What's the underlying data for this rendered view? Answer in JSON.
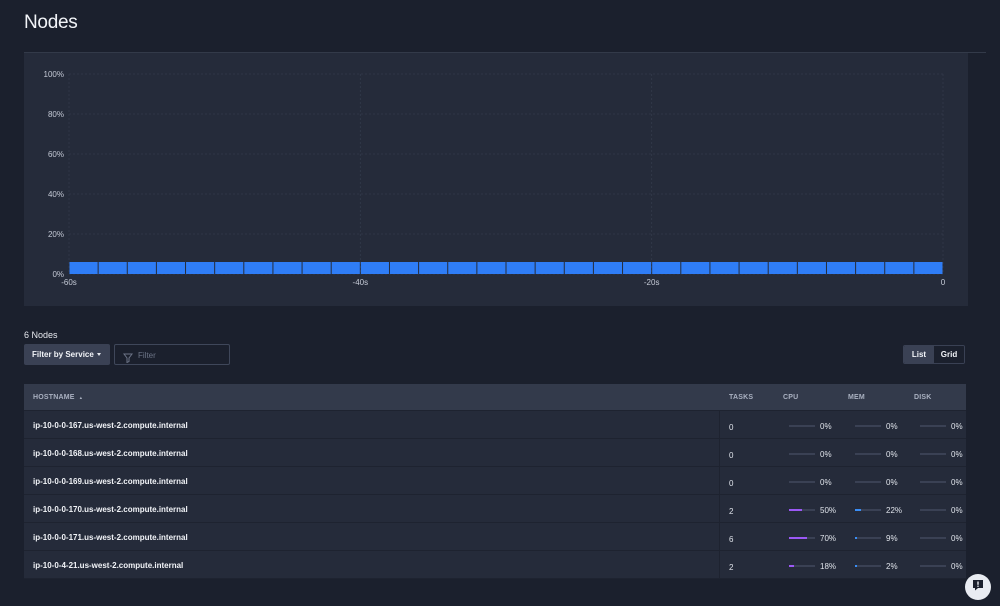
{
  "page": {
    "title": "Nodes"
  },
  "chart_data": {
    "type": "bar",
    "title": "",
    "xlabel": "",
    "ylabel": "",
    "y_ticks": [
      "100%",
      "80%",
      "60%",
      "40%",
      "20%",
      "0%"
    ],
    "x_ticks": [
      "-60s",
      "-40s",
      "-20s",
      "0"
    ],
    "ylim": [
      0,
      100
    ],
    "xlim": [
      -60,
      0
    ],
    "x": [
      -60,
      -58,
      -56,
      -54,
      -52,
      -50,
      -48,
      -46,
      -44,
      -42,
      -40,
      -38,
      -36,
      -34,
      -32,
      -30,
      -28,
      -26,
      -24,
      -22,
      -20,
      -18,
      -16,
      -14,
      -12,
      -10,
      -8,
      -6,
      -4,
      -2
    ],
    "values": [
      6,
      6,
      6,
      6,
      6,
      6,
      6,
      6,
      6,
      6,
      6,
      6,
      6,
      6,
      6,
      6,
      6,
      6,
      6,
      6,
      6,
      6,
      6,
      6,
      6,
      6,
      6,
      6,
      6,
      6
    ],
    "bar_color": "#2f7df6",
    "grid": true
  },
  "toolbar": {
    "node_count": "6 Nodes",
    "filter_service_label": "Filter by Service",
    "filter_placeholder": "Filter",
    "view_list": "List",
    "view_grid": "Grid"
  },
  "table": {
    "columns": {
      "hostname": "HOSTNAME",
      "tasks": "TASKS",
      "cpu": "CPU",
      "mem": "MEM",
      "disk": "DISK"
    },
    "sort_indicator": "▲",
    "cpu_color": "#9b59f5",
    "mem_color": "#3a8ef6",
    "rows": [
      {
        "hostname": "ip-10-0-0-167.us-west-2.compute.internal",
        "tasks": "0",
        "cpu": "0%",
        "cpu_value": 0,
        "mem": "0%",
        "mem_value": 0,
        "disk": "0%",
        "disk_value": 0
      },
      {
        "hostname": "ip-10-0-0-168.us-west-2.compute.internal",
        "tasks": "0",
        "cpu": "0%",
        "cpu_value": 0,
        "mem": "0%",
        "mem_value": 0,
        "disk": "0%",
        "disk_value": 0
      },
      {
        "hostname": "ip-10-0-0-169.us-west-2.compute.internal",
        "tasks": "0",
        "cpu": "0%",
        "cpu_value": 0,
        "mem": "0%",
        "mem_value": 0,
        "disk": "0%",
        "disk_value": 0
      },
      {
        "hostname": "ip-10-0-0-170.us-west-2.compute.internal",
        "tasks": "2",
        "cpu": "50%",
        "cpu_value": 50,
        "mem": "22%",
        "mem_value": 22,
        "disk": "0%",
        "disk_value": 0
      },
      {
        "hostname": "ip-10-0-0-171.us-west-2.compute.internal",
        "tasks": "6",
        "cpu": "70%",
        "cpu_value": 70,
        "mem": "9%",
        "mem_value": 9,
        "disk": "0%",
        "disk_value": 0
      },
      {
        "hostname": "ip-10-0-4-21.us-west-2.compute.internal",
        "tasks": "2",
        "cpu": "18%",
        "cpu_value": 18,
        "mem": "2%",
        "mem_value": 2,
        "disk": "0%",
        "disk_value": 0
      }
    ]
  },
  "help": {
    "icon": "chat-help-icon"
  }
}
